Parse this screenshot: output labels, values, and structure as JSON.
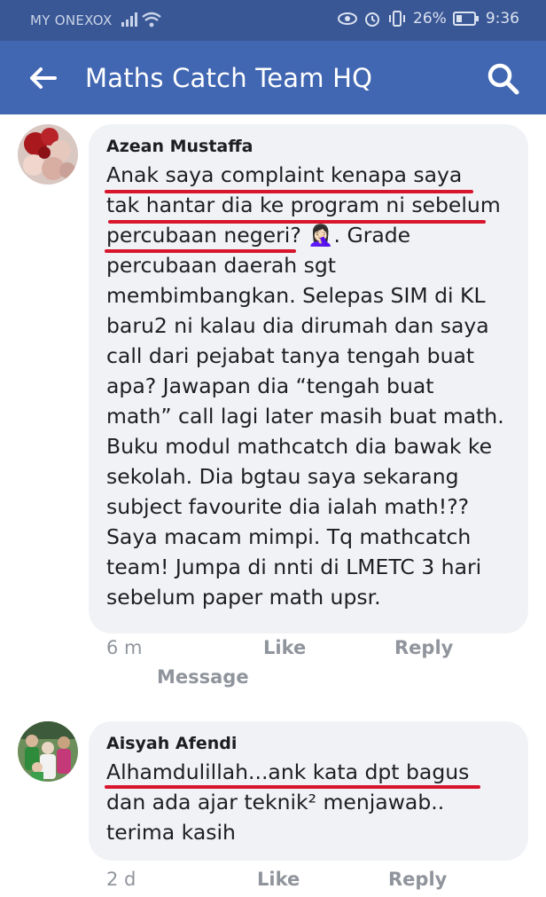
{
  "status_bar": {
    "carrier": "MY ONEXOX",
    "battery": "26%",
    "time": "9:36"
  },
  "header": {
    "title": "Maths Catch Team HQ",
    "back_icon": "arrow-left-icon",
    "search_icon": "search-icon"
  },
  "colors": {
    "status_bar": "#3a5795",
    "app_bar": "#4267b2",
    "bubble": "#f0f2f5",
    "underline": "#d8152c",
    "action_text": "#90949c"
  },
  "comments": [
    {
      "author": "Azean Mustaffa",
      "lines": [
        "Anak saya complaint kenapa saya",
        "tak hantar dia ke program ni sebelum",
        "percubaan negeri? 🤦🏻‍♀️.  Grade",
        "percubaan daerah sgt",
        "membimbangkan. Selepas SIM di KL",
        "baru2 ni kalau dia dirumah dan saya",
        "call dari pejabat tanya tengah buat",
        "apa? Jawapan dia “tengah buat",
        "math” call lagi later masih buat math.",
        "Buku modul mathcatch dia bawak ke",
        "sekolah. Dia bgtau saya sekarang",
        "subject favourite dia ialah math!??",
        "Saya macam mimpi. Tq mathcatch",
        "team! Jumpa di nnti di LMETC 3 hari",
        "sebelum paper math upsr."
      ],
      "time": "6 m",
      "like": "Like",
      "reply": "Reply",
      "message": "Message"
    },
    {
      "author": "Aisyah Afendi",
      "lines": [
        "Alhamdulillah...ank kata dpt bagus",
        "dan ada ajar teknik² menjawab..",
        "terima kasih"
      ],
      "time": "2 d",
      "like": "Like",
      "reply": "Reply"
    }
  ]
}
